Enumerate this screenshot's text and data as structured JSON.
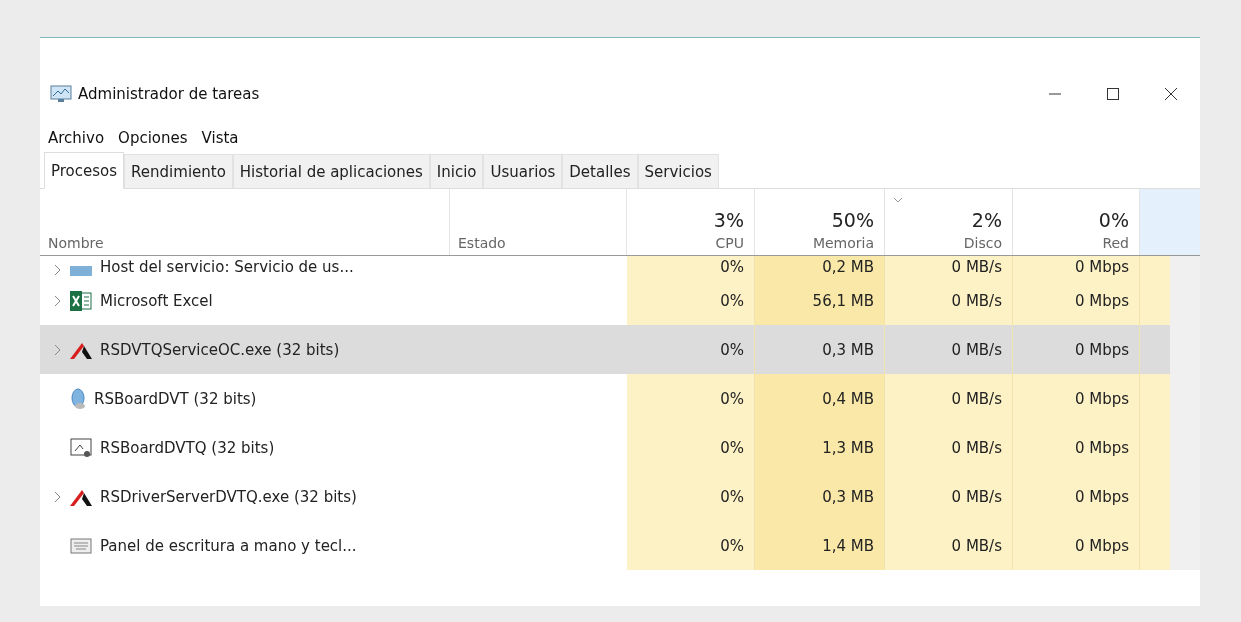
{
  "window": {
    "title": "Administrador de tareas"
  },
  "menu": [
    "Archivo",
    "Opciones",
    "Vista"
  ],
  "tabs": [
    {
      "label": "Procesos",
      "selected": true
    },
    {
      "label": "Rendimiento",
      "selected": false
    },
    {
      "label": "Historial de aplicaciones",
      "selected": false
    },
    {
      "label": "Inicio",
      "selected": false
    },
    {
      "label": "Usuarios",
      "selected": false
    },
    {
      "label": "Detalles",
      "selected": false
    },
    {
      "label": "Servicios",
      "selected": false
    }
  ],
  "table": {
    "columns": [
      {
        "label": "Nombre",
        "sorted": false
      },
      {
        "label": "Estado",
        "sorted": false
      },
      {
        "usage": "3%",
        "label": "CPU",
        "sorted": false
      },
      {
        "usage": "50%",
        "label": "Memoria",
        "sorted": false
      },
      {
        "usage": "2%",
        "label": "Disco",
        "sorted": true
      },
      {
        "usage": "0%",
        "label": "Red",
        "sorted": false
      }
    ],
    "rows": [
      {
        "name": "Host del servicio: Servicio de us...",
        "kind": "service",
        "expandable": true,
        "selected": false,
        "cpu": "0%",
        "memory": "0,2 MB",
        "disk": "0 MB/s",
        "network": "0 Mbps"
      },
      {
        "name": "Microsoft Excel",
        "kind": "excel",
        "expandable": true,
        "selected": false,
        "cpu": "0%",
        "memory": "56,1 MB",
        "disk": "0 MB/s",
        "network": "0 Mbps"
      },
      {
        "name": "RSDVTQServiceOC.exe (32 bits)",
        "kind": "rs",
        "expandable": true,
        "selected": true,
        "cpu": "0%",
        "memory": "0,3 MB",
        "disk": "0 MB/s",
        "network": "0 Mbps"
      },
      {
        "name": "RSBoardDVT (32 bits)",
        "kind": "mouse",
        "expandable": false,
        "selected": false,
        "cpu": "0%",
        "memory": "0,4 MB",
        "disk": "0 MB/s",
        "network": "0 Mbps"
      },
      {
        "name": "RSBoardDVTQ (32 bits)",
        "kind": "app",
        "expandable": false,
        "selected": false,
        "cpu": "0%",
        "memory": "1,3 MB",
        "disk": "0 MB/s",
        "network": "0 Mbps"
      },
      {
        "name": "RSDriverServerDVTQ.exe (32 bits)",
        "kind": "rs",
        "expandable": true,
        "selected": false,
        "cpu": "0%",
        "memory": "0,3 MB",
        "disk": "0 MB/s",
        "network": "0 Mbps"
      },
      {
        "name": "Panel de escritura a mano y tecl...",
        "kind": "keyboard",
        "expandable": false,
        "selected": false,
        "cpu": "0%",
        "memory": "1,4 MB",
        "disk": "0 MB/s",
        "network": "0 Mbps"
      }
    ]
  }
}
